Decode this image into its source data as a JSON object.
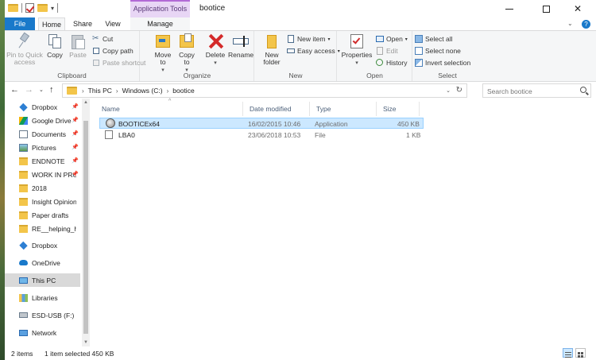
{
  "window": {
    "title": "bootice",
    "app_tools_label": "Application Tools"
  },
  "tabs": [
    "File",
    "Home",
    "Share",
    "View",
    "Manage"
  ],
  "ribbon": {
    "clipboard": {
      "label": "Clipboard",
      "pin_label": "Pin to Quick access",
      "copy_label": "Copy",
      "paste_label": "Paste",
      "cut_label": "Cut",
      "copy_path_label": "Copy path",
      "paste_shortcut_label": "Paste shortcut"
    },
    "organize": {
      "label": "Organize",
      "move_to_label": "Move to",
      "copy_to_label": "Copy to",
      "delete_label": "Delete",
      "rename_label": "Rename"
    },
    "new": {
      "label": "New",
      "new_folder_label": "New folder",
      "new_item_label": "New item",
      "easy_access_label": "Easy access"
    },
    "open": {
      "label": "Open",
      "properties_label": "Properties",
      "open_label": "Open",
      "edit_label": "Edit",
      "history_label": "History"
    },
    "select": {
      "label": "Select",
      "select_all_label": "Select all",
      "select_none_label": "Select none",
      "invert_label": "Invert selection"
    }
  },
  "address": {
    "crumbs": [
      "This PC",
      "Windows (C:)",
      "bootice"
    ],
    "search_placeholder": "Search bootice"
  },
  "nav": {
    "items": [
      {
        "label": "Dropbox",
        "icon": "dropbox-icon",
        "pinned": true
      },
      {
        "label": "Google Drive",
        "icon": "google-drive-icon",
        "pinned": true
      },
      {
        "label": "Documents",
        "icon": "documents-icon",
        "pinned": true
      },
      {
        "label": "Pictures",
        "icon": "pictures-icon",
        "pinned": true
      },
      {
        "label": "ENDNOTE",
        "icon": "folder-icon",
        "pinned": true
      },
      {
        "label": "WORK IN PRO",
        "icon": "folder-icon",
        "pinned": true
      },
      {
        "label": "2018",
        "icon": "folder-icon",
        "pinned": false
      },
      {
        "label": "Insight Opinion",
        "icon": "folder-icon",
        "pinned": false
      },
      {
        "label": "Paper drafts",
        "icon": "folder-icon",
        "pinned": false
      },
      {
        "label": "RE__helping_han",
        "icon": "folder-icon",
        "pinned": false
      },
      {
        "label": "Dropbox",
        "icon": "dropbox-icon",
        "pinned": false
      },
      {
        "label": "OneDrive",
        "icon": "onedrive-icon",
        "pinned": false
      },
      {
        "label": "This PC",
        "icon": "this-pc-icon",
        "pinned": false
      },
      {
        "label": "Libraries",
        "icon": "libraries-icon",
        "pinned": false
      },
      {
        "label": "ESD-USB (F:)",
        "icon": "usb-drive-icon",
        "pinned": false
      },
      {
        "label": "Network",
        "icon": "network-icon",
        "pinned": false
      }
    ]
  },
  "filelist": {
    "columns": [
      "Name",
      "Date modified",
      "Type",
      "Size"
    ],
    "rows": [
      {
        "name": "BOOTICEx64",
        "date": "16/02/2015 10:46",
        "type": "Application",
        "size": "450 KB",
        "selected": true
      },
      {
        "name": "LBA0",
        "date": "23/06/2018 10:53",
        "type": "File",
        "size": "1 KB",
        "selected": false
      }
    ]
  },
  "status": {
    "count": "2 items",
    "selection": "1 item selected  450 KB"
  },
  "colors": {
    "file_tab": "#1979ca",
    "selection": "#cce8ff",
    "app_tools": "#e8d6f5"
  }
}
